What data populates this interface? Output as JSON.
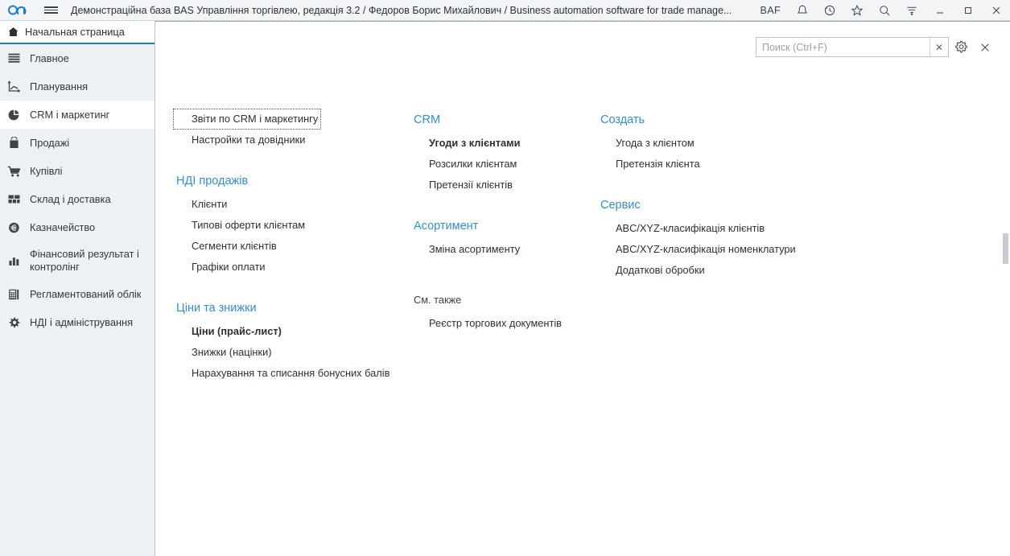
{
  "titlebar": {
    "logo_icon": "baf-infinity-logo",
    "menu_icon": "hamburger-menu-icon",
    "title": "Демонстраційна база BAS Управління торгівлею, редакція 3.2 / Федоров Борис Михайлович / Business automation software for trade manage...",
    "baf_label": "BAF",
    "icons": [
      {
        "name": "bell-icon",
        "glyph": "bell"
      },
      {
        "name": "history-clock-icon",
        "glyph": "clock"
      },
      {
        "name": "star-favorites-icon",
        "glyph": "star"
      },
      {
        "name": "search-icon",
        "glyph": "magnifier"
      },
      {
        "name": "filter-funnel-icon",
        "glyph": "funnel"
      }
    ],
    "window_buttons": [
      {
        "name": "minimize-button",
        "glyph": "_"
      },
      {
        "name": "maximize-button",
        "glyph": "□"
      },
      {
        "name": "close-button",
        "glyph": "✕"
      }
    ],
    "accent": "#1a7fc1",
    "background": "#f2f4f6"
  },
  "tab": {
    "label": "Начальная страница",
    "icon": "home-icon",
    "underline_color": "#1a7fc1"
  },
  "sidebar": {
    "items": [
      {
        "label": "Главное",
        "icon": "list-lines-icon",
        "active": false
      },
      {
        "label": "Планування",
        "icon": "planning-chart-icon",
        "active": false
      },
      {
        "label": "CRM і маркетинг",
        "icon": "pie-chart-icon",
        "active": true
      },
      {
        "label": "Продажі",
        "icon": "shopping-bag-icon",
        "active": false
      },
      {
        "label": "Купівлі",
        "icon": "shopping-cart-icon",
        "active": false
      },
      {
        "label": "Склад і доставка",
        "icon": "grid-blocks-icon",
        "active": false
      },
      {
        "label": "Казначейство",
        "icon": "currency-circle-icon",
        "active": false
      },
      {
        "label": "Фінансовий результат і контролінг",
        "icon": "bar-chart-icon",
        "active": false
      },
      {
        "label": "Регламентований облік",
        "icon": "calculator-icon",
        "active": false
      },
      {
        "label": "НДІ і адміністрування",
        "icon": "gear-icon",
        "active": false
      }
    ]
  },
  "search": {
    "placeholder": "Поиск (Ctrl+F)",
    "value": "",
    "clear_glyph": "✕",
    "gear_icon": "gear-icon",
    "close_icon": "close-icon"
  },
  "main": {
    "columns": [
      {
        "groups": [
          {
            "title": null,
            "links": [
              {
                "label": "Звіти по CRM і маркетингу",
                "bold": false,
                "focused": true
              },
              {
                "label": "Настройки та довідники",
                "bold": false,
                "focused": false
              }
            ]
          },
          {
            "title": "НДІ продажів",
            "title_style": "link",
            "links": [
              {
                "label": "Клієнти",
                "bold": false,
                "focused": false
              },
              {
                "label": "Типові оферти клієнтам",
                "bold": false,
                "focused": false
              },
              {
                "label": "Сегменти клієнтів",
                "bold": false,
                "focused": false
              },
              {
                "label": "Графіки оплати",
                "bold": false,
                "focused": false
              }
            ]
          },
          {
            "title": "Ціни та знижки",
            "title_style": "link",
            "links": [
              {
                "label": "Ціни (прайс-лист)",
                "bold": true,
                "focused": false
              },
              {
                "label": "Знижки (націнки)",
                "bold": false,
                "focused": false
              },
              {
                "label": "Нарахування та списання бонусних балів",
                "bold": false,
                "focused": false
              }
            ]
          }
        ]
      },
      {
        "groups": [
          {
            "title": "CRM",
            "title_style": "link",
            "links": [
              {
                "label": "Угоди з клієнтами",
                "bold": true,
                "focused": false
              },
              {
                "label": "Розсилки клієнтам",
                "bold": false,
                "focused": false
              },
              {
                "label": "Претензії клієнтів",
                "bold": false,
                "focused": false
              }
            ]
          },
          {
            "title": "Асортимент",
            "title_style": "link",
            "links": [
              {
                "label": "Зміна асортименту",
                "bold": false,
                "focused": false
              }
            ]
          },
          {
            "title": "См. также",
            "title_style": "plain",
            "links": [
              {
                "label": "Реєстр торгових документів",
                "bold": false,
                "focused": false
              }
            ]
          }
        ]
      },
      {
        "groups": [
          {
            "title": "Создать",
            "title_style": "link",
            "links": [
              {
                "label": "Угода з клієнтом",
                "bold": false,
                "focused": false
              },
              {
                "label": "Претензія клієнта",
                "bold": false,
                "focused": false
              }
            ]
          },
          {
            "title": "Сервис",
            "title_style": "link",
            "links": [
              {
                "label": "ABC/XYZ-класифікація клієнтів",
                "bold": false,
                "focused": false
              },
              {
                "label": "ABC/XYZ-класифікація номенклатури",
                "bold": false,
                "focused": false
              },
              {
                "label": "Додаткові обробки",
                "bold": false,
                "focused": false
              }
            ]
          }
        ]
      }
    ]
  },
  "colors": {
    "link_blue": "#2f8fd4",
    "sidebar_bg": "#edf1f4",
    "text": "#2b3035"
  }
}
